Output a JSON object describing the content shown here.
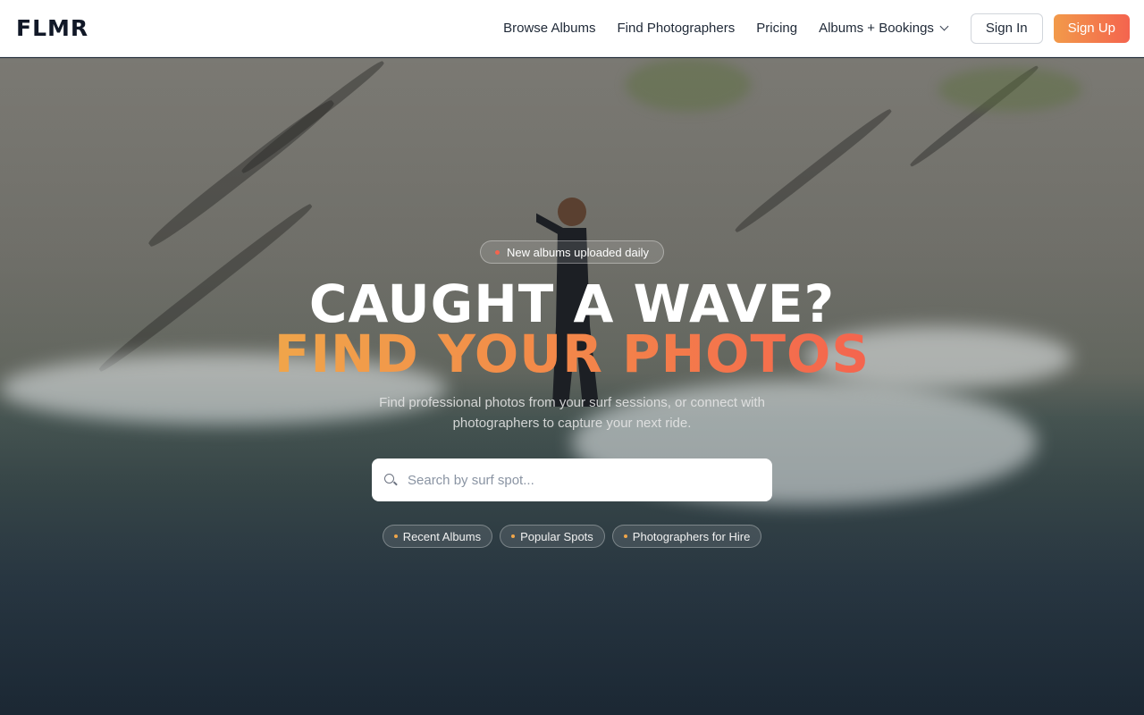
{
  "brand": {
    "logo": "FLMR"
  },
  "nav": {
    "links": [
      "Browse Albums",
      "Find Photographers",
      "Pricing"
    ],
    "dropdown_label": "Albums + Bookings",
    "sign_in": "Sign In",
    "sign_up": "Sign Up"
  },
  "hero": {
    "badge": "New albums uploaded daily",
    "headline_line1": "CAUGHT A WAVE?",
    "headline_line2": "FIND YOUR PHOTOS",
    "subtitle": "Find professional photos from your surf sessions, or connect with photographers to capture your next ride.",
    "search_placeholder": "Search by surf spot...",
    "chips": [
      "Recent Albums",
      "Popular Spots",
      "Photographers for Hire"
    ]
  },
  "colors": {
    "accent_start": "#f0a54a",
    "accent_end": "#f4644e"
  },
  "icons": {
    "search": "search-icon",
    "dropdown": "chevron-down-icon"
  }
}
